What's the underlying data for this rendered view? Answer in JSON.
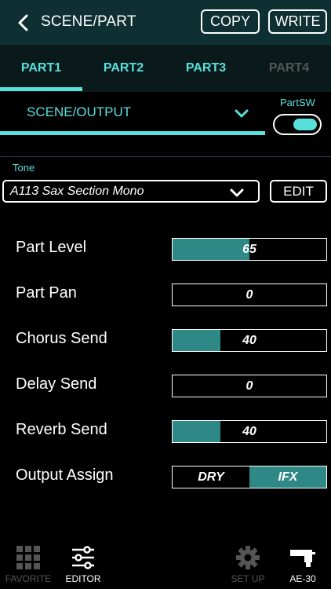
{
  "header": {
    "title": "SCENE/PART",
    "copy_label": "COPY",
    "write_label": "WRITE"
  },
  "tabs": [
    {
      "label": "PART1",
      "active": true
    },
    {
      "label": "PART2",
      "active": false
    },
    {
      "label": "PART3",
      "active": false
    },
    {
      "label": "PART4",
      "active": false,
      "disabled": true
    }
  ],
  "scene": {
    "label": "SCENE/OUTPUT",
    "partsw_label": "PartSW",
    "partsw_on": true
  },
  "tone": {
    "label": "Tone",
    "value": "A113 Sax Section Mono",
    "edit_label": "EDIT"
  },
  "params": [
    {
      "label": "Part Level",
      "value": "65",
      "fill_fraction": 0.5
    },
    {
      "label": "Part Pan",
      "value": "0",
      "fill_fraction": 0
    },
    {
      "label": "Chorus Send",
      "value": "40",
      "fill_fraction": 0.31
    },
    {
      "label": "Delay Send",
      "value": "0",
      "fill_fraction": 0
    },
    {
      "label": "Reverb Send",
      "value": "40",
      "fill_fraction": 0.31
    }
  ],
  "output_assign": {
    "label": "Output Assign",
    "options": [
      "DRY",
      "IFX"
    ],
    "selected": "IFX"
  },
  "nav": [
    {
      "label": "FAVORITE",
      "icon": "grid-icon",
      "dim": true
    },
    {
      "label": "EDITOR",
      "icon": "sliders-icon",
      "dim": false
    },
    {
      "label": "SET UP",
      "icon": "gear-icon",
      "dim": true
    },
    {
      "label": "AE-30",
      "icon": "device-icon",
      "dim": false
    }
  ],
  "colors": {
    "accent": "#58e0dc",
    "fill": "#2e8885",
    "header_bg": "#0f3032"
  }
}
